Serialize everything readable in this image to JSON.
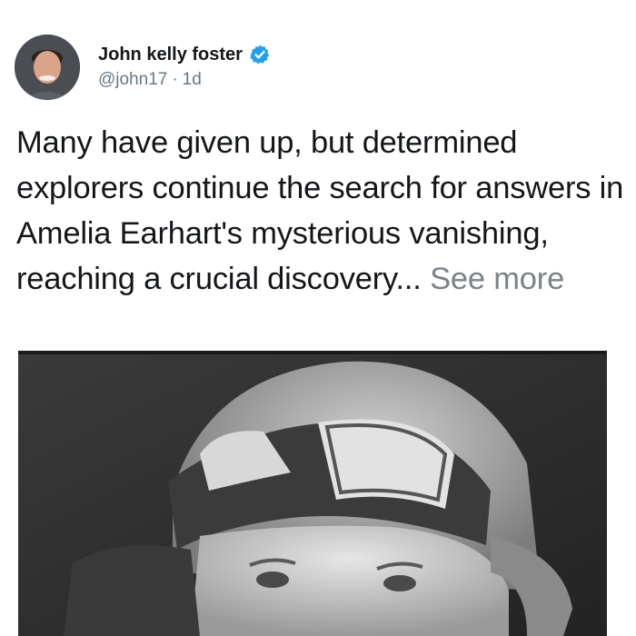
{
  "post": {
    "author": {
      "display_name": "John kelly foster",
      "handle": "@john17",
      "separator": "·",
      "time": "1d",
      "verified": true
    },
    "text": "Many have given up, but determined explorers continue the search for answers in Amelia Earhart's mysterious vanishing, reaching a crucial discovery...",
    "see_more_label": "See more",
    "colors": {
      "verified_badge": "#1da1f2",
      "secondary_text": "#657786",
      "see_more": "#7a838b"
    }
  }
}
